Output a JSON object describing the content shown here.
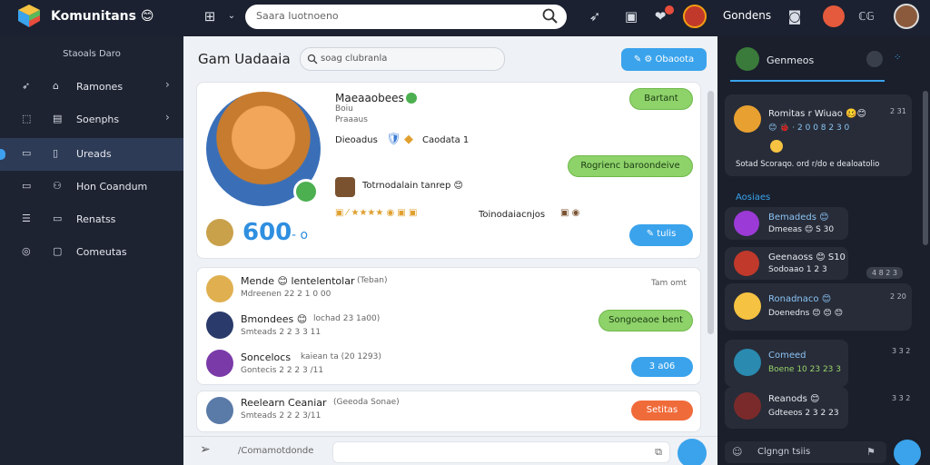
{
  "topbar": {
    "app_title": "Komunitans 😊",
    "search_placeholder": "Saara Iuotnoeno",
    "user_label": "Gondens"
  },
  "sidebar": {
    "heading": "Staoals Daro",
    "items": [
      {
        "label": "Ramones"
      },
      {
        "label": "Soenphs"
      },
      {
        "label": "Ureads"
      },
      {
        "label": "Hon Coandum"
      },
      {
        "label": "Renatss"
      },
      {
        "label": "Comeutas"
      }
    ]
  },
  "main": {
    "title": "Gam Uadaaia",
    "search_placeholder": "soag clubranla",
    "action_button": "Obaoota",
    "profile": {
      "name": "Maeaaobees",
      "line2": "Boiu",
      "line3": "Praaaus",
      "stat_label": "Dieoadus",
      "stat_value": "Caodata 1",
      "pill_top": "Bartant",
      "pill_mid": "Rogrienc baroondeive",
      "activity1": "Totrnodalain tanrep 😊",
      "activity2": "Toinodaiacnjos",
      "score": "600",
      "score_suffix": "- o",
      "pill_blue": "tulis"
    },
    "posts": [
      {
        "name": "Mende 😊 lentelentolar",
        "meta": "(Teban)",
        "sub": "Mdreenen 22 2 1 0 00",
        "time": "Tam omt"
      },
      {
        "name": "Bmondees 😊",
        "meta": "lochad 23 1a00)",
        "sub": "Smteads 2 2 3 3 11",
        "pill": "Songoeaoe bent"
      },
      {
        "name": "Soncelocs",
        "meta": "kaiean ta (20 1293)",
        "sub": "Gontecis 2 2 2 3 /11",
        "pill": "3 a06"
      }
    ],
    "post4": {
      "name": "Reelearn Ceaniar",
      "meta": "(Geeoda Sonae)",
      "sub": "Smteads 2 2 2 3/11",
      "pill": "Setitas"
    },
    "bottom_label": "/Comamotdonde"
  },
  "rpanel": {
    "header": "Genmeos",
    "msg1": {
      "title": "Romitas r Wiuao 🥴😊",
      "line2": "😊 🐞 · 2 0 0 8 2 3 0",
      "foot": "Sotad Scoraqo. ord r/do e dealoatolio",
      "time": "2 31"
    },
    "section": "Aosiaes",
    "msg2": {
      "title": "Bemadeds 😊",
      "line2": "Dmeeas 😊 S 30"
    },
    "msg3": {
      "title": "Geenaoss 😊 S10",
      "line2": "Sodoaao 1 2 3",
      "time": "4 8 2 3"
    },
    "msg4": {
      "title": "Ronadnaco 😊",
      "line2": "Doenedns 😊 😊 😊",
      "time": "2 20"
    },
    "msg5": {
      "title": "Comeed",
      "line2": "Boene 10 23 23 3",
      "time": "3 3 2"
    },
    "msg6": {
      "title": "Reanods 😊",
      "line2": "Gdteeos 2 3 2 23",
      "time": "3 3 2"
    },
    "input_placeholder": "Clgngn tsiis"
  }
}
